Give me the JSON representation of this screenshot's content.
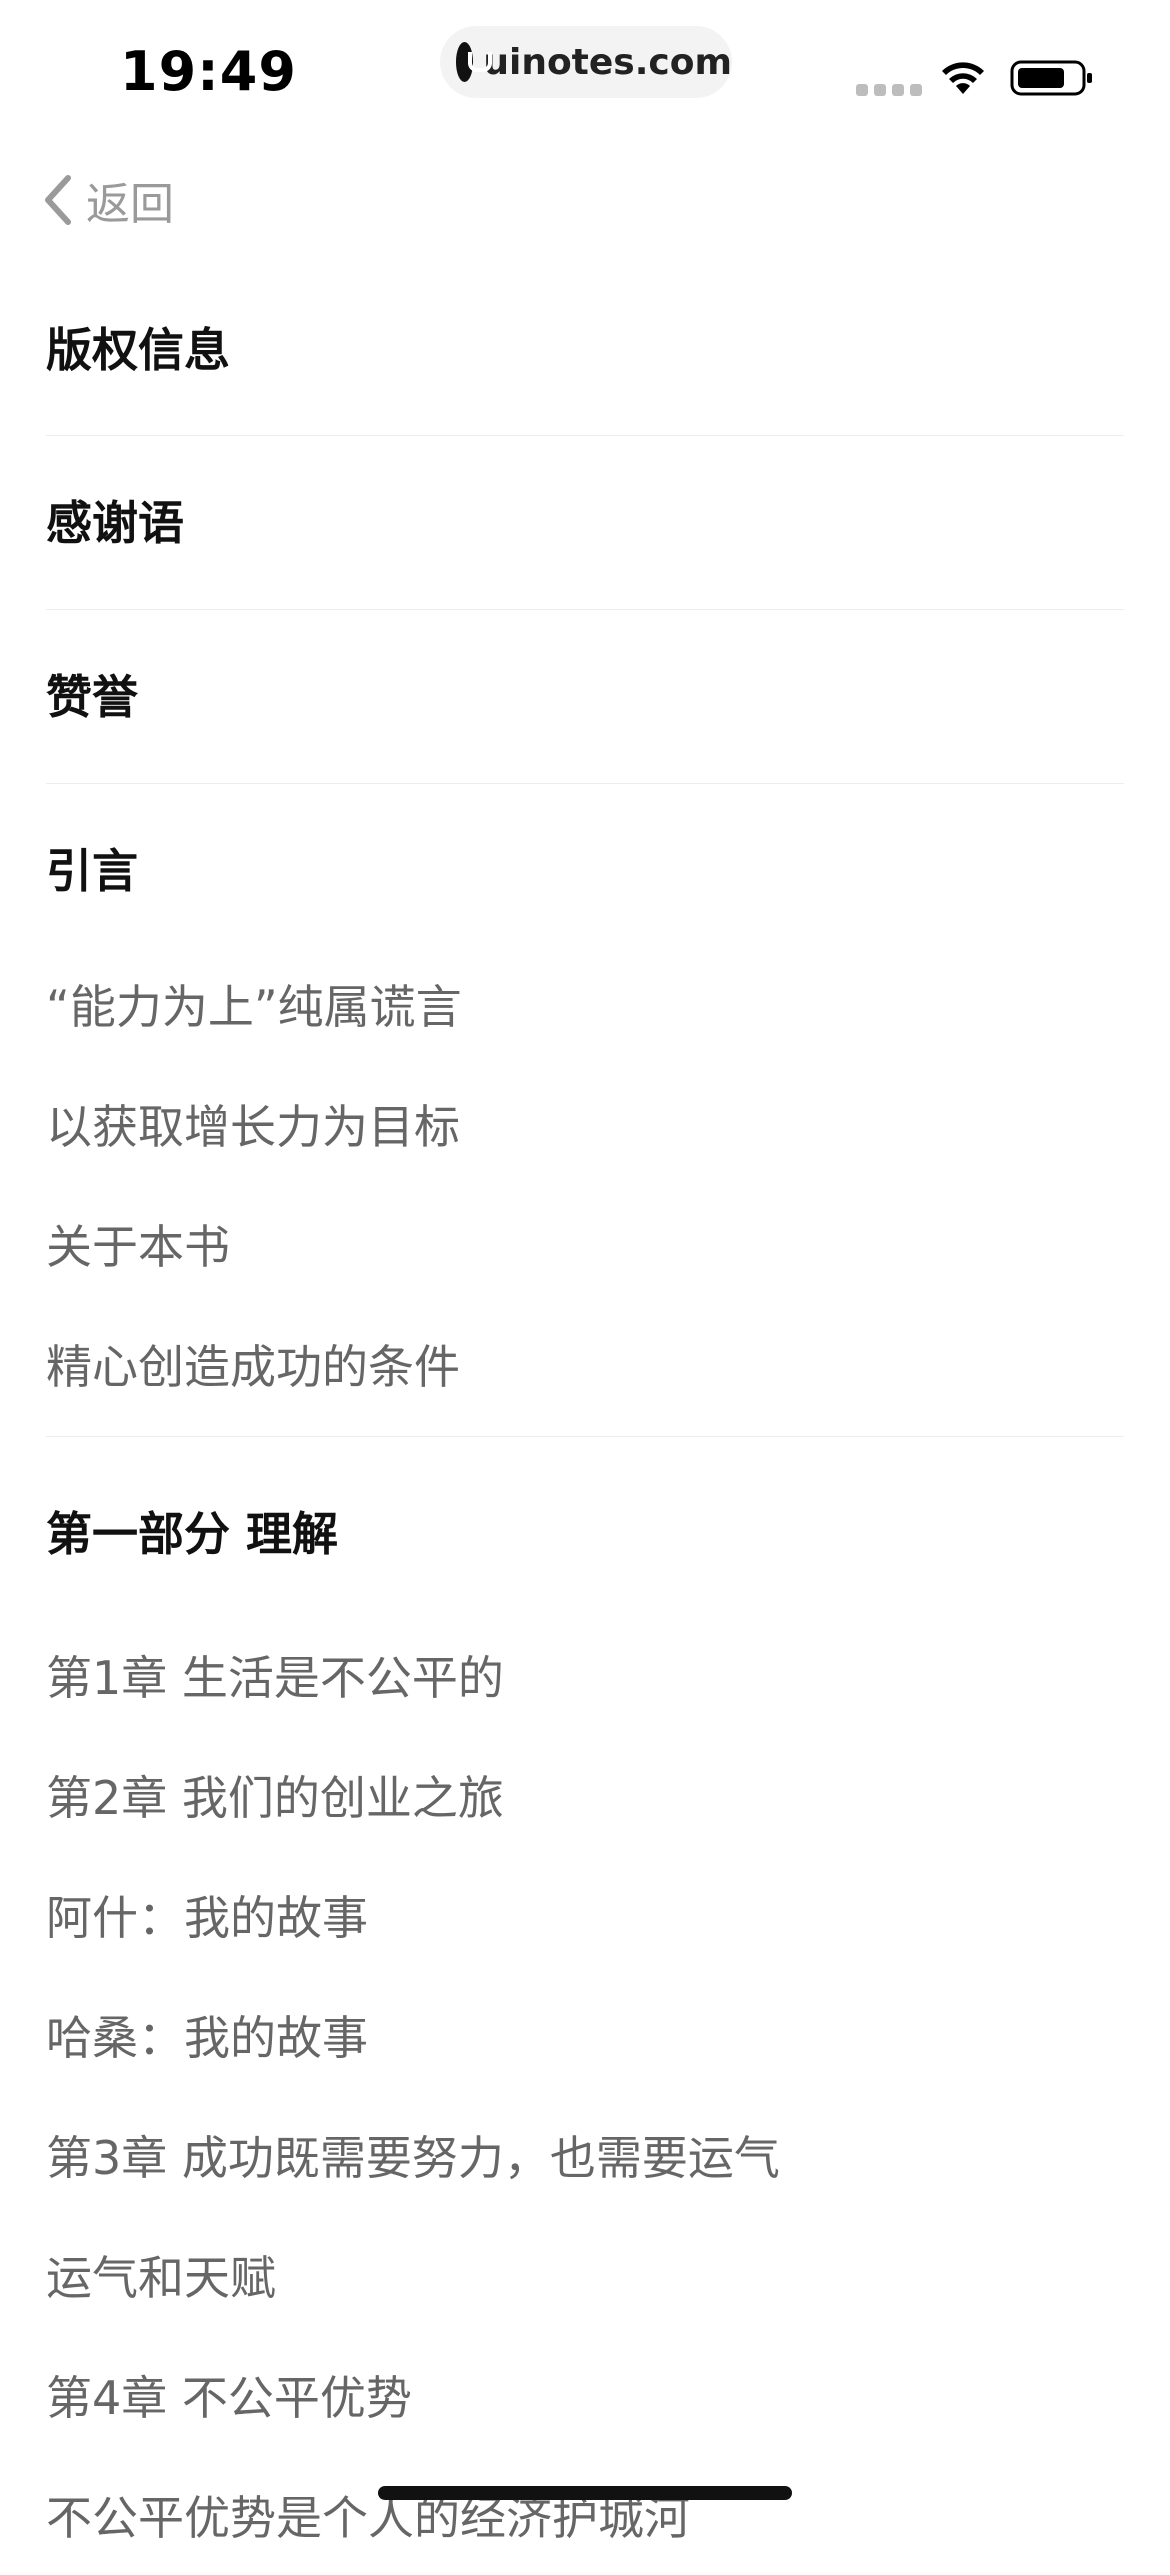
{
  "status_bar": {
    "time": "19:49",
    "url": "uinotes.com"
  },
  "nav": {
    "back_label": "返回"
  },
  "toc": {
    "sections": [
      {
        "title": "版权信息"
      },
      {
        "title": "感谢语"
      },
      {
        "title": "赞誉"
      },
      {
        "title": "引言",
        "items": [
          "“能力为上”纯属谎言",
          "以获取增长力为目标",
          "关于本书",
          "精心创造成功的条件"
        ]
      },
      {
        "title": "第一部分 理解",
        "items": [
          "第1章 生活是不公平的",
          "第2章 我们的创业之旅",
          "阿什：我的故事",
          "哈桑：我的故事",
          "第3章 成功既需要努力，也需要运气",
          "运气和天赋",
          "第4章 不公平优势",
          "不公平优势是个人的经济护城河"
        ]
      }
    ]
  },
  "colors": {
    "title": "#111111",
    "entry": "#666666",
    "divider": "#ededed",
    "back": "#9a9a9a"
  }
}
